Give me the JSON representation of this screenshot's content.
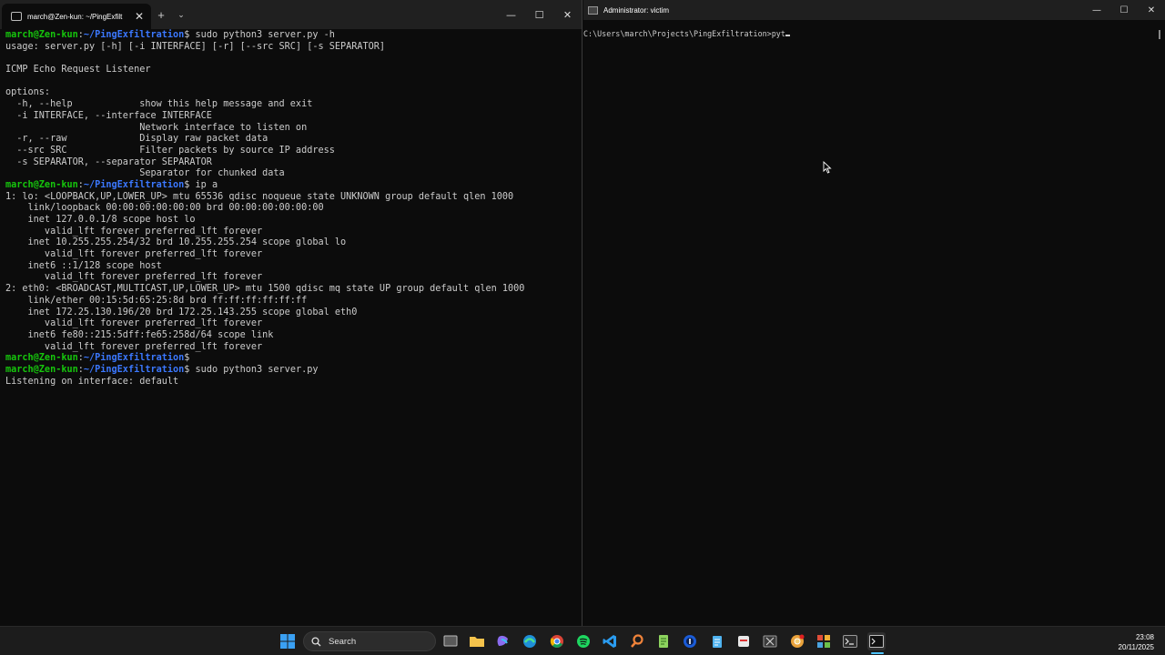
{
  "left_window": {
    "tab_title": "march@Zen-kun: ~/PingExfilt",
    "new_tab": "+",
    "dropdown": "⌄",
    "terminal_lines": [
      {
        "user": "march@Zen-kun",
        "path": "~/PingExfiltration",
        "cmd": "$ sudo python3 server.py -h"
      },
      {
        "text": "usage: server.py [-h] [-i INTERFACE] [-r] [--src SRC] [-s SEPARATOR]"
      },
      {
        "text": ""
      },
      {
        "text": "ICMP Echo Request Listener"
      },
      {
        "text": ""
      },
      {
        "text": "options:"
      },
      {
        "text": "  -h, --help            show this help message and exit"
      },
      {
        "text": "  -i INTERFACE, --interface INTERFACE"
      },
      {
        "text": "                        Network interface to listen on"
      },
      {
        "text": "  -r, --raw             Display raw packet data"
      },
      {
        "text": "  --src SRC             Filter packets by source IP address"
      },
      {
        "text": "  -s SEPARATOR, --separator SEPARATOR"
      },
      {
        "text": "                        Separator for chunked data"
      },
      {
        "user": "march@Zen-kun",
        "path": "~/PingExfiltration",
        "cmd": "$ ip a"
      },
      {
        "text": "1: lo: <LOOPBACK,UP,LOWER_UP> mtu 65536 qdisc noqueue state UNKNOWN group default qlen 1000"
      },
      {
        "text": "    link/loopback 00:00:00:00:00:00 brd 00:00:00:00:00:00"
      },
      {
        "text": "    inet 127.0.0.1/8 scope host lo"
      },
      {
        "text": "       valid_lft forever preferred_lft forever"
      },
      {
        "text": "    inet 10.255.255.254/32 brd 10.255.255.254 scope global lo"
      },
      {
        "text": "       valid_lft forever preferred_lft forever"
      },
      {
        "text": "    inet6 ::1/128 scope host"
      },
      {
        "text": "       valid_lft forever preferred_lft forever"
      },
      {
        "text": "2: eth0: <BROADCAST,MULTICAST,UP,LOWER_UP> mtu 1500 qdisc mq state UP group default qlen 1000"
      },
      {
        "text": "    link/ether 00:15:5d:65:25:8d brd ff:ff:ff:ff:ff:ff"
      },
      {
        "text": "    inet 172.25.130.196/20 brd 172.25.143.255 scope global eth0"
      },
      {
        "text": "       valid_lft forever preferred_lft forever"
      },
      {
        "text": "    inet6 fe80::215:5dff:fe65:258d/64 scope link"
      },
      {
        "text": "       valid_lft forever preferred_lft forever"
      },
      {
        "user": "march@Zen-kun",
        "path": "~/PingExfiltration",
        "cmd": "$"
      },
      {
        "user": "march@Zen-kun",
        "path": "~/PingExfiltration",
        "cmd": "$ sudo python3 server.py"
      },
      {
        "text": "Listening on interface: default"
      }
    ]
  },
  "right_window": {
    "title": "Administrator: victim",
    "prompt": "C:\\Users\\march\\Projects\\PingExfiltration>pyt"
  },
  "taskbar": {
    "search_placeholder": "Search",
    "time": "23:08",
    "date": "20/11/2025",
    "icons": [
      "windows-start-icon",
      "task-view-icon",
      "file-explorer-icon",
      "copilot-icon",
      "edge-icon",
      "chrome-icon",
      "spotify-icon",
      "vscode-icon",
      "search-app-icon",
      "notepad-plus-plus-icon",
      "onepassword-icon",
      "notepad-icon",
      "app-icon",
      "snipping-tool-icon",
      "chrome-canary-icon",
      "app-grid-icon",
      "terminal-icon",
      "cmd-icon"
    ]
  },
  "colors": {
    "prompt_user": "#16c60c",
    "prompt_path": "#3b78ff",
    "terminal_text": "#cccccc",
    "background": "#0c0c0c",
    "taskbar": "#1c1c1c"
  }
}
